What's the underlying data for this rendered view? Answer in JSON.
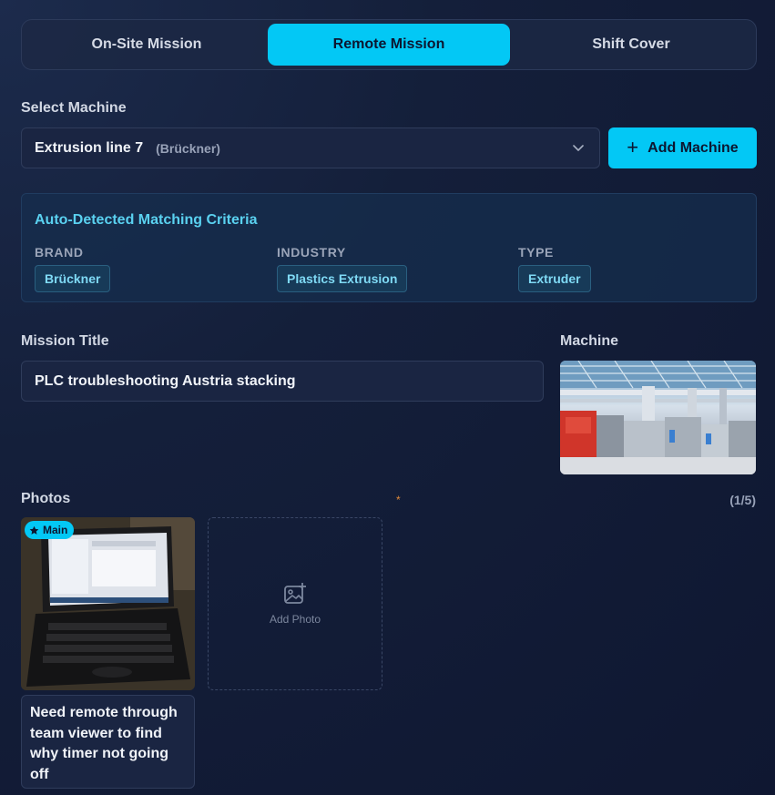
{
  "tabs": [
    {
      "label": "On-Site Mission",
      "active": false
    },
    {
      "label": "Remote Mission",
      "active": true
    },
    {
      "label": "Shift Cover",
      "active": false
    }
  ],
  "select_machine": {
    "label": "Select Machine",
    "value": "Extrusion line 7",
    "brand": "(Brückner)",
    "add_button": "Add Machine"
  },
  "criteria": {
    "title": "Auto-Detected Matching Criteria",
    "items": [
      {
        "heading": "BRAND",
        "value": "Brückner"
      },
      {
        "heading": "INDUSTRY",
        "value": "Plastics Extrusion"
      },
      {
        "heading": "TYPE",
        "value": "Extruder"
      }
    ]
  },
  "mission_title": {
    "label": "Mission Title",
    "value": "PLC troubleshooting Austria stacking"
  },
  "machine": {
    "label": "Machine"
  },
  "photos": {
    "label": "Photos",
    "required_mark": "*",
    "count": "(1/5)",
    "main_badge": "Main",
    "add_photo_label": "Add Photo",
    "caption": "Need remote through team viewer to find why timer not going off"
  },
  "colors": {
    "accent": "#03c8f5",
    "background": "#141f3a",
    "criteria_text": "#5ad1f0"
  }
}
